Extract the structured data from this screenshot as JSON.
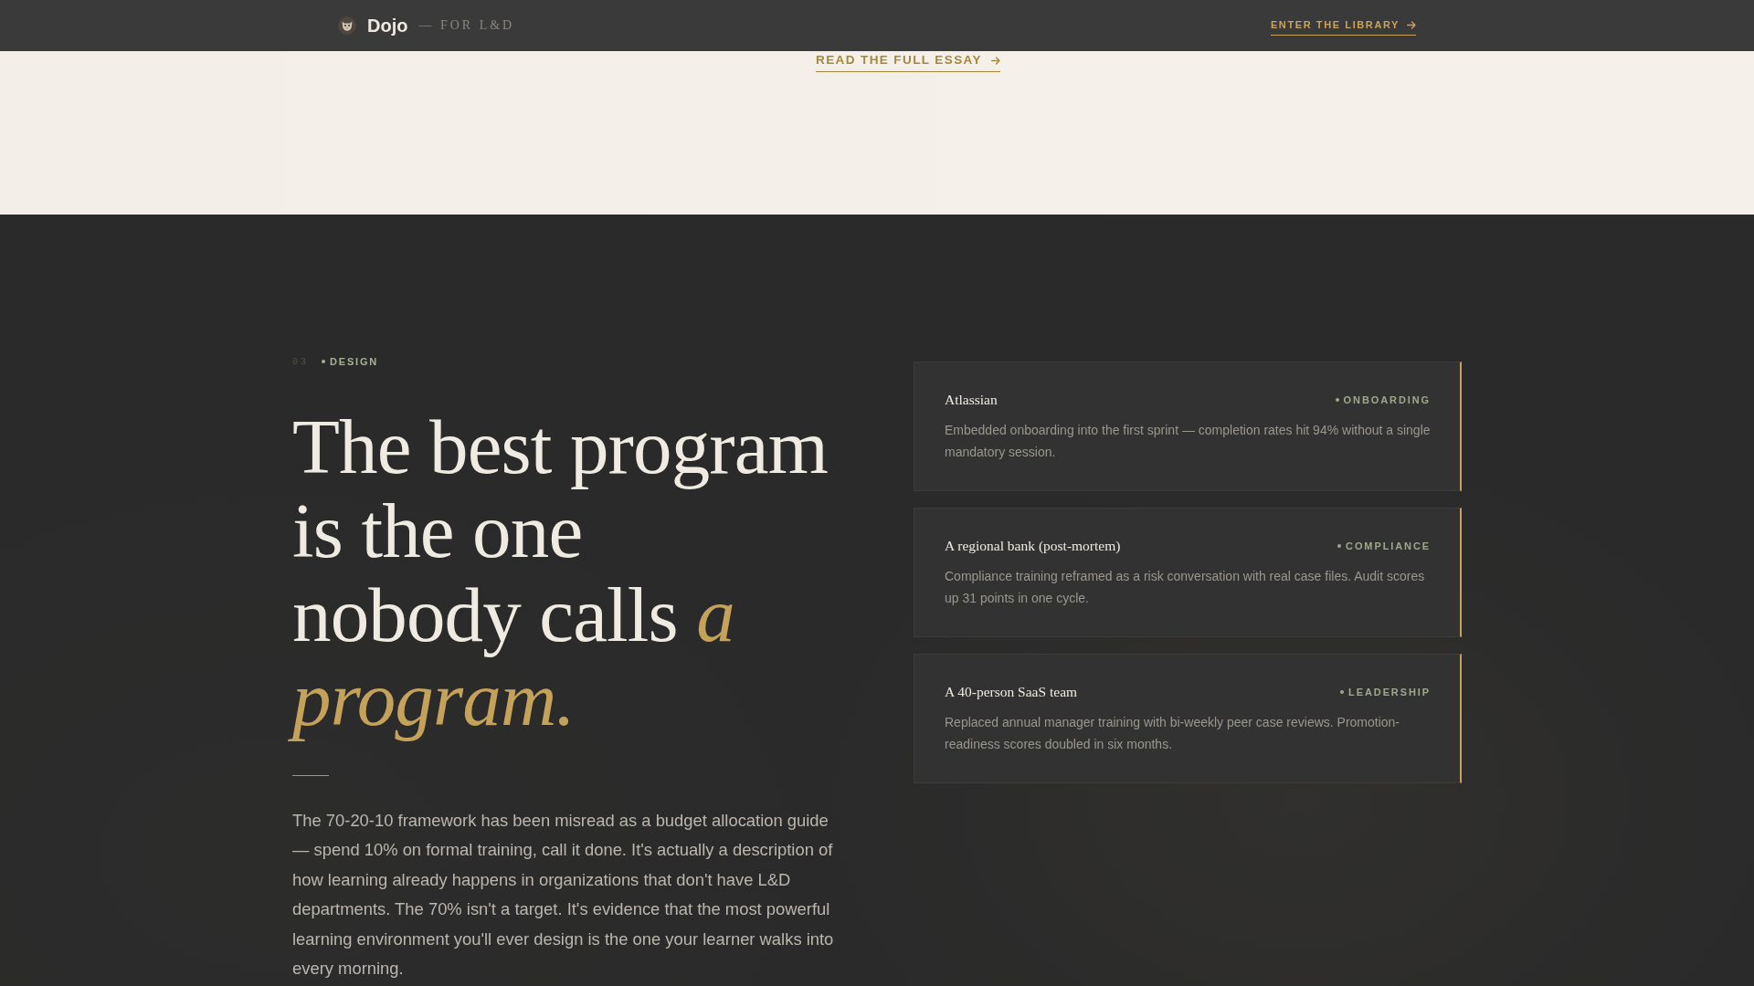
{
  "nav": {
    "brand": "Dojo",
    "tagline": "— FOR L&D",
    "link": "ENTER THE LIBRARY"
  },
  "intro": {
    "link": "READ THE FULL ESSAY"
  },
  "feature": {
    "number": "03",
    "label": "DESIGN",
    "heading": "The best program\nis the one\nnobody calls *a*\n*program.*",
    "body": "The 70-20-10 framework has been misread as a budget allocation guide — spend 10% on formal training, call it done. It's actually a description of how learning already happens in organizations that don't have L&D departments. The 70% isn't a target. It's evidence that the most powerful learning environment you'll ever design is the one your learner walks into every morning."
  },
  "cases": [
    {
      "company": "Atlassian",
      "tag": "ONBOARDING",
      "summary": "Embedded onboarding into the first sprint — completion rates hit 94% without a single mandatory session."
    },
    {
      "company": "A regional bank (post-mortem)",
      "tag": "COMPLIANCE",
      "summary": "Compliance training reframed as a risk conversation with real case files. Audit scores up 31 points in one cycle."
    },
    {
      "company": "A 40-person SaaS team",
      "tag": "LEADERSHIP",
      "summary": "Replaced annual manager training with bi-weekly peer case reviews. Promotion-readiness scores doubled in six months."
    }
  ]
}
